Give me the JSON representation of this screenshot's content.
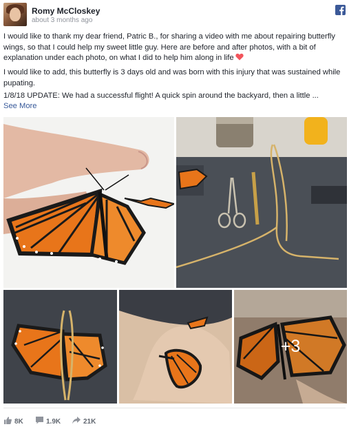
{
  "post": {
    "author": "Romy McCloskey",
    "timestamp": "about 3 months ago",
    "paragraph_1": "I would like to thank my dear friend, Patric B., for sharing a video with me about repairing butterfly wings, so that I could help my sweet little guy. Here are before and after photos, with a bit of explanation under each photo, on what I did to help him along in life",
    "paragraph_2": "I would like to add, this butterfly is 3 days old and was born with this injury that was sustained while pupating.",
    "paragraph_3": "1/8/18 UPDATE: We had a successful flight! A quick spin around the backyard, then a little ...",
    "see_more": "See More"
  },
  "photos": {
    "count_more": "+3"
  },
  "stats": {
    "likes": "8K",
    "comments": "1.9K",
    "shares": "21K"
  },
  "colors": {
    "facebook_blue": "#3b5998",
    "link_blue": "#365899",
    "heart_red": "#f2545b",
    "monarch_orange": "#e8751a"
  },
  "icons": [
    "facebook-logo-icon",
    "heart-icon",
    "like-icon",
    "comment-icon",
    "share-icon"
  ]
}
